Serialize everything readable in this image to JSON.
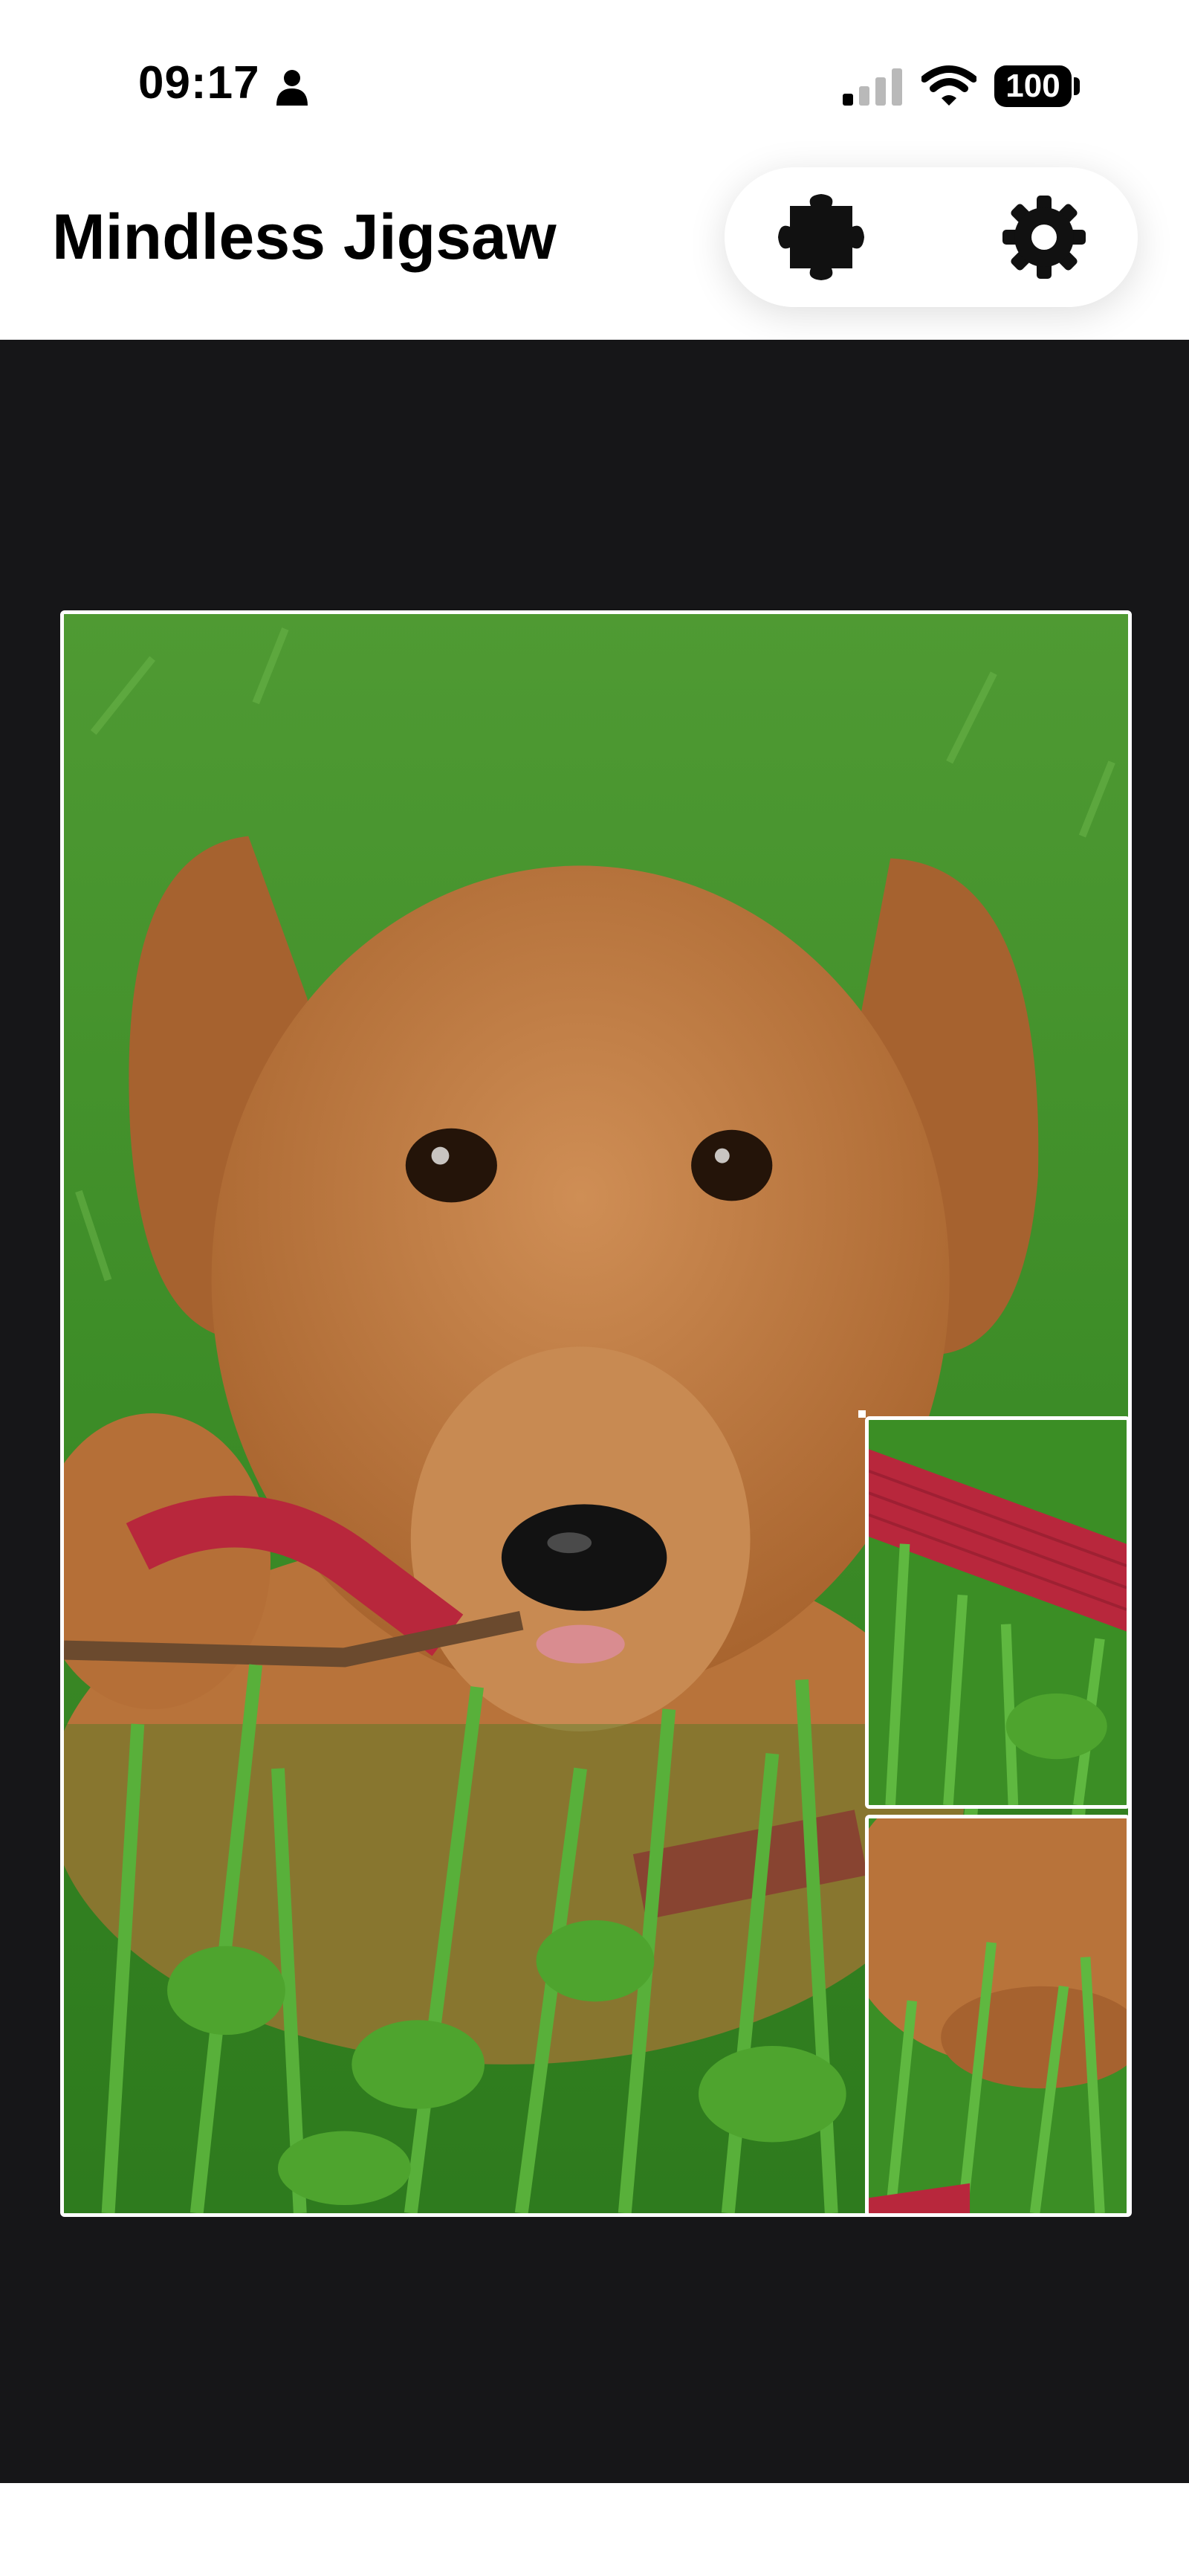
{
  "status_bar": {
    "time": "09:17",
    "battery": "100",
    "icons": [
      "person-icon",
      "cellular-signal-icon",
      "wifi-icon",
      "battery-icon"
    ]
  },
  "header": {
    "title": "Mindless Jigsaw",
    "actions": [
      {
        "name": "puzzle-button",
        "icon": "puzzle-piece-icon"
      },
      {
        "name": "settings-button",
        "icon": "gear-icon"
      }
    ]
  },
  "board": {
    "background": "#161618",
    "piece_border": "#ffffff",
    "pieces": [
      {
        "name": "puzzle-piece-main",
        "icon": "puppy-image",
        "placed": true
      },
      {
        "name": "puzzle-piece-loose-1",
        "icon": "red-leash-grass-image",
        "placed": false
      },
      {
        "name": "puzzle-piece-loose-2",
        "icon": "paw-grass-image",
        "placed": false
      }
    ]
  },
  "colors": {
    "grass": "#3f9a2c",
    "fur": "#c27f45",
    "leash": "#b8273c"
  }
}
